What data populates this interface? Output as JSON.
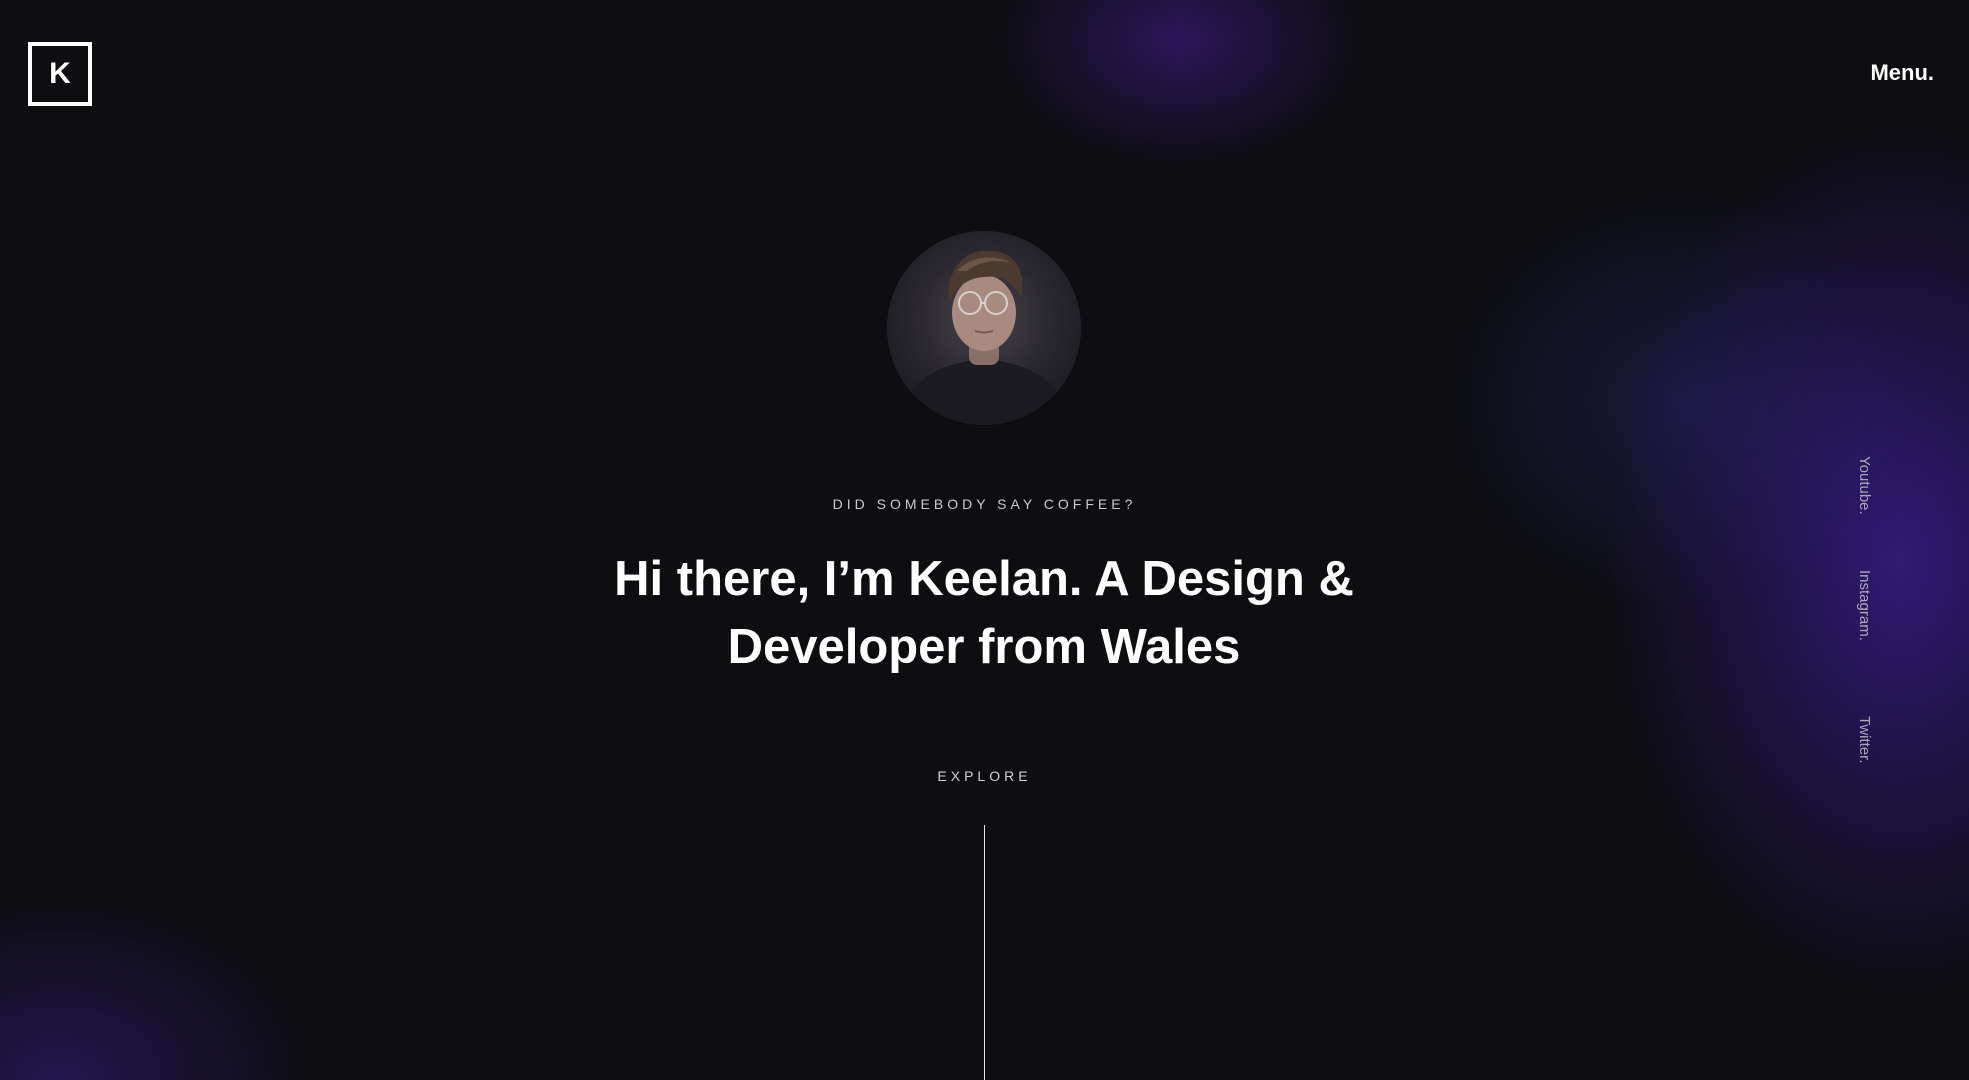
{
  "header": {
    "logo_letter": "K",
    "menu_label": "Menu."
  },
  "hero": {
    "eyebrow": "DID SOMEBODY SAY COFFEE?",
    "headline_line1": "Hi there, I’m Keelan. A Design &",
    "headline_line2": "Developer from Wales",
    "explore_label": "EXPLORE"
  },
  "social": {
    "youtube": "Youtube.",
    "instagram": "Instagram.",
    "twitter": "Twitter."
  },
  "colors": {
    "background": "#0d0d12",
    "accent_glow": "#3c1e96",
    "text": "#ffffff",
    "muted_text": "#a9a9b6"
  }
}
